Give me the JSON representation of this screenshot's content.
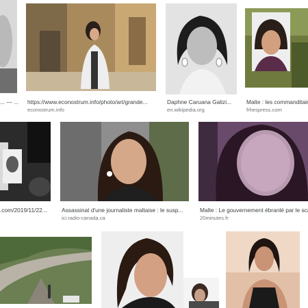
{
  "results": [
    {
      "caption": "... — ...",
      "source": ""
    },
    {
      "caption": "https://www.econostrum.info/photo/art/grande...",
      "source": "econostrum.info"
    },
    {
      "caption": "Daphne Caruana Galizi...",
      "source": "en.wikipedia.org"
    },
    {
      "caption": "Malte : les commanditair...",
      "source": "frhespress.com"
    },
    {
      "caption": ".com/2019/11/22...",
      "source": ""
    },
    {
      "caption": "Assassinat d'une journaliste maltaise : le susp...",
      "source": "ici.radio-canada.ca"
    },
    {
      "caption": "Malte : Le gouvernement ébranlé par le sca...",
      "source": "20minutes.fr"
    },
    {
      "caption": "",
      "source": ""
    },
    {
      "caption": "",
      "source": ""
    },
    {
      "caption": "",
      "source": ""
    },
    {
      "caption": "",
      "source": ""
    }
  ]
}
